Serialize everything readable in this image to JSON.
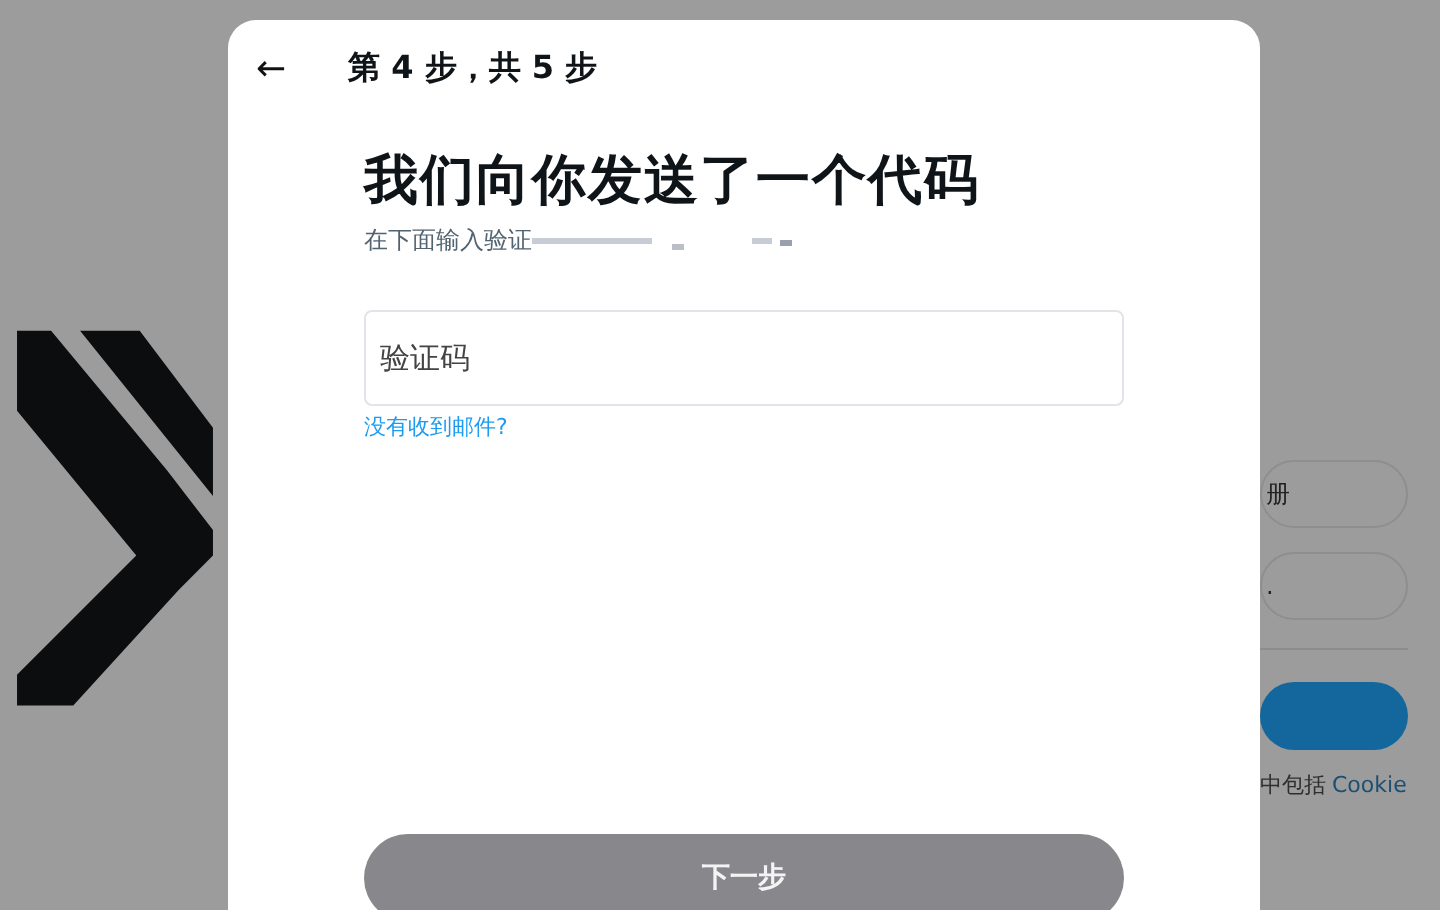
{
  "background": {
    "buttons": [
      {
        "label": "册",
        "kind": "outline"
      },
      {
        "label": ".",
        "kind": "outline"
      },
      {
        "kind": "primary"
      }
    ],
    "note": "中包括",
    "note_link": "Cookie"
  },
  "dialog": {
    "back_icon": "←",
    "step": "第 4 步，共 5 步",
    "title": "我们向你发送了一个代码",
    "subtitle": "在下面输入验证",
    "subtitle_redacted": true,
    "field": {
      "placeholder": "验证码"
    },
    "help_link": "没有收到邮件?",
    "next_button": {
      "label": "下一步",
      "disabled": true
    }
  }
}
